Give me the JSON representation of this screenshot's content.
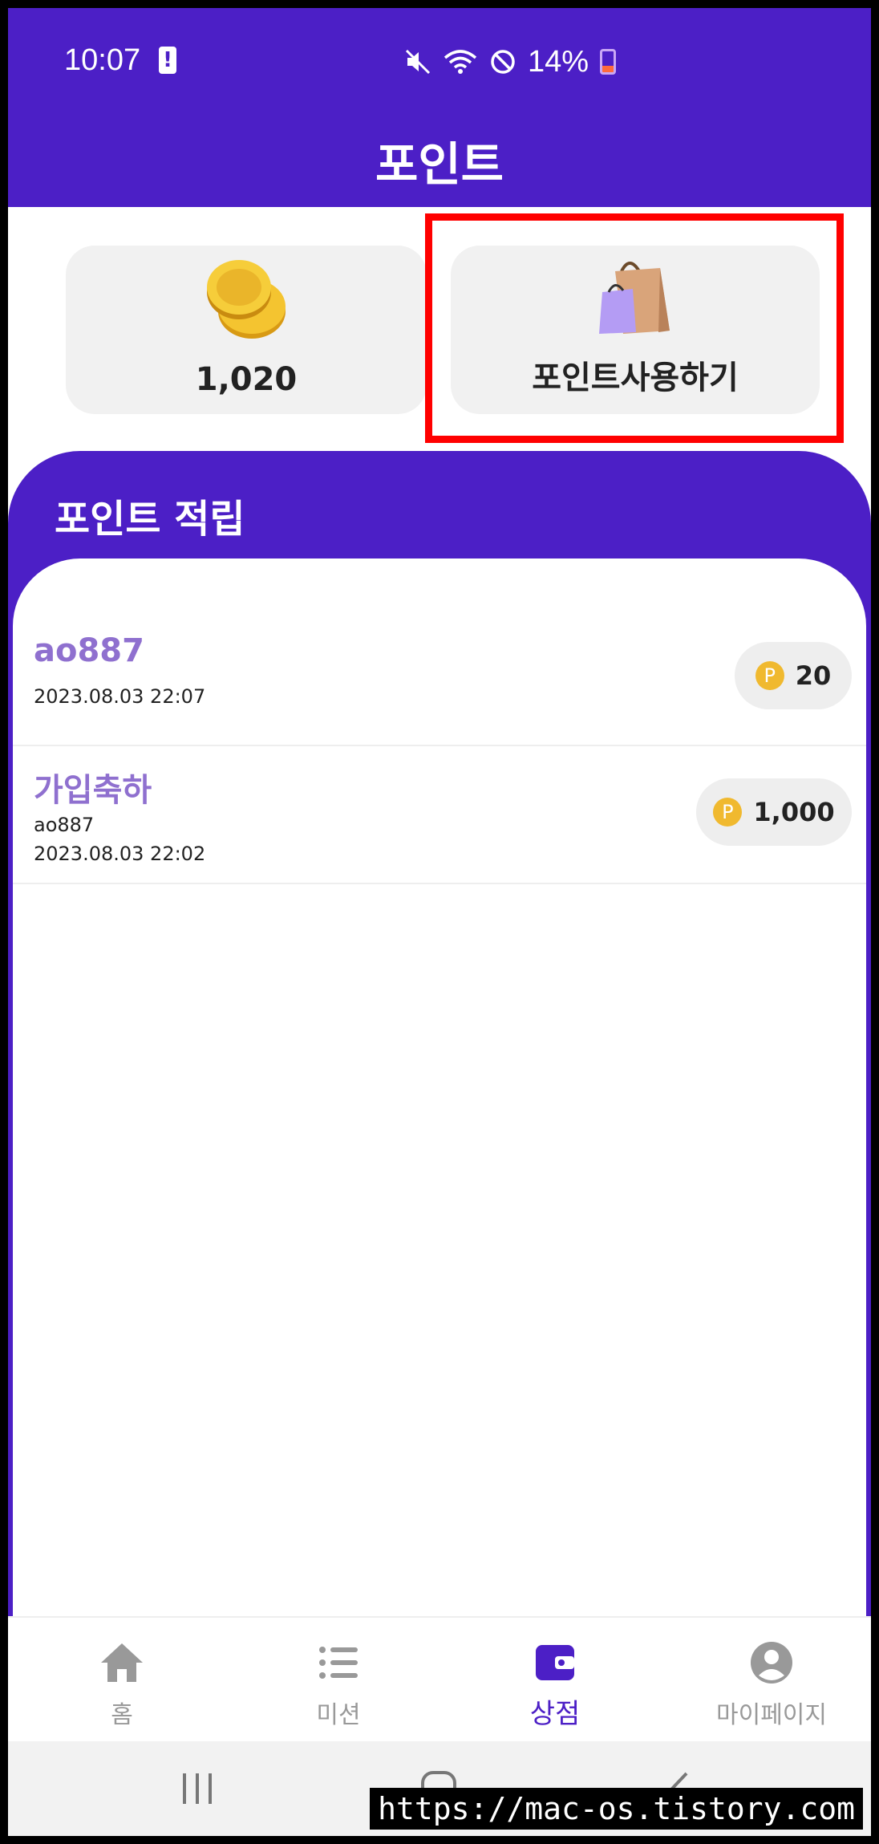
{
  "status_bar": {
    "time": "10:07",
    "battery_percent": "14%"
  },
  "header": {
    "title": "포인트"
  },
  "cards": {
    "points_balance": "1,020",
    "use_points_label": "포인트사용하기"
  },
  "section": {
    "title": "포인트 적립",
    "items": [
      {
        "title": "ao887",
        "sub1": "2023.08.03 22:07",
        "sub2": "",
        "points": "20"
      },
      {
        "title": "가입축하",
        "sub1": "ao887",
        "sub2": "2023.08.03 22:02",
        "points": "1,000"
      }
    ],
    "point_badge": "P"
  },
  "bottom_nav": {
    "items": [
      {
        "label": "홈",
        "icon": "home-icon"
      },
      {
        "label": "미션",
        "icon": "list-icon"
      },
      {
        "label": "상점",
        "icon": "wallet-icon",
        "active": true
      },
      {
        "label": "마이페이지",
        "icon": "user-icon"
      }
    ]
  },
  "watermark": "https://mac-os.tistory.com",
  "colors": {
    "primary": "#4c1fc6",
    "accent_text": "#8f70cf",
    "highlight": "#ff0000",
    "coin": "#f0b92f"
  }
}
